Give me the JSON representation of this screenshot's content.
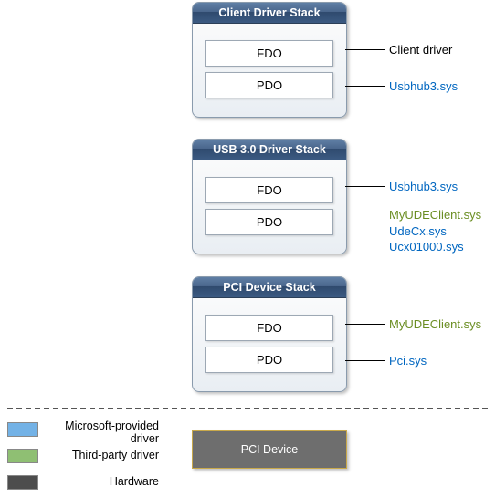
{
  "stacks": [
    {
      "title": "Client Driver Stack",
      "fdo": "FDO",
      "pdo": "PDO"
    },
    {
      "title": "USB 3.0 Driver Stack",
      "fdo": "FDO",
      "pdo": "PDO"
    },
    {
      "title": "PCI Device Stack",
      "fdo": "FDO",
      "pdo": "PDO"
    }
  ],
  "labels": {
    "s0_fdo": "Client driver",
    "s0_pdo": "Usbhub3.sys",
    "s1_fdo": "Usbhub3.sys",
    "s1_pdo_a": "MyUDEClient.sys",
    "s1_pdo_b": "UdeCx.sys",
    "s1_pdo_c": "Ucx01000.sys",
    "s2_fdo": "MyUDEClient.sys",
    "s2_pdo": "Pci.sys"
  },
  "legend": {
    "ms": "Microsoft-provided driver",
    "tp": "Third-party driver",
    "hw": "Hardware"
  },
  "device": "PCI Device"
}
